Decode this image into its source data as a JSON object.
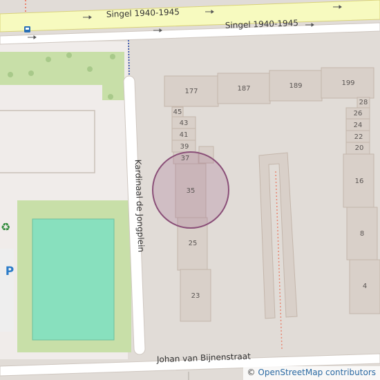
{
  "streets": {
    "singel_top": "Singel 1940-1945",
    "singel_bottom": "Singel 1940-1945",
    "kardinaal": "Kardinaal de Jongplein",
    "johan": "Johan van Bijnenstraat"
  },
  "house_numbers": [
    "177",
    "187",
    "189",
    "199",
    "45",
    "43",
    "41",
    "39",
    "37",
    "35",
    "25",
    "23",
    "28",
    "26",
    "24",
    "22",
    "20",
    "16",
    "8",
    "4"
  ],
  "icons": [
    "bus-stop-icon",
    "recycling-icon",
    "parking-icon",
    "one-way-arrow-icon"
  ],
  "map_features": [
    "location-highlight-circle"
  ],
  "attribution": {
    "symbol": "©",
    "text": "OpenStreetMap contributors"
  },
  "colors": {
    "background": "#e1dcd7",
    "road": "#ffffff",
    "primary_road": "#f7fabf",
    "grass": "#c8dfa8",
    "pitch": "#88e0be",
    "building": "#d9d0c9",
    "highlight": "#a0648c"
  }
}
